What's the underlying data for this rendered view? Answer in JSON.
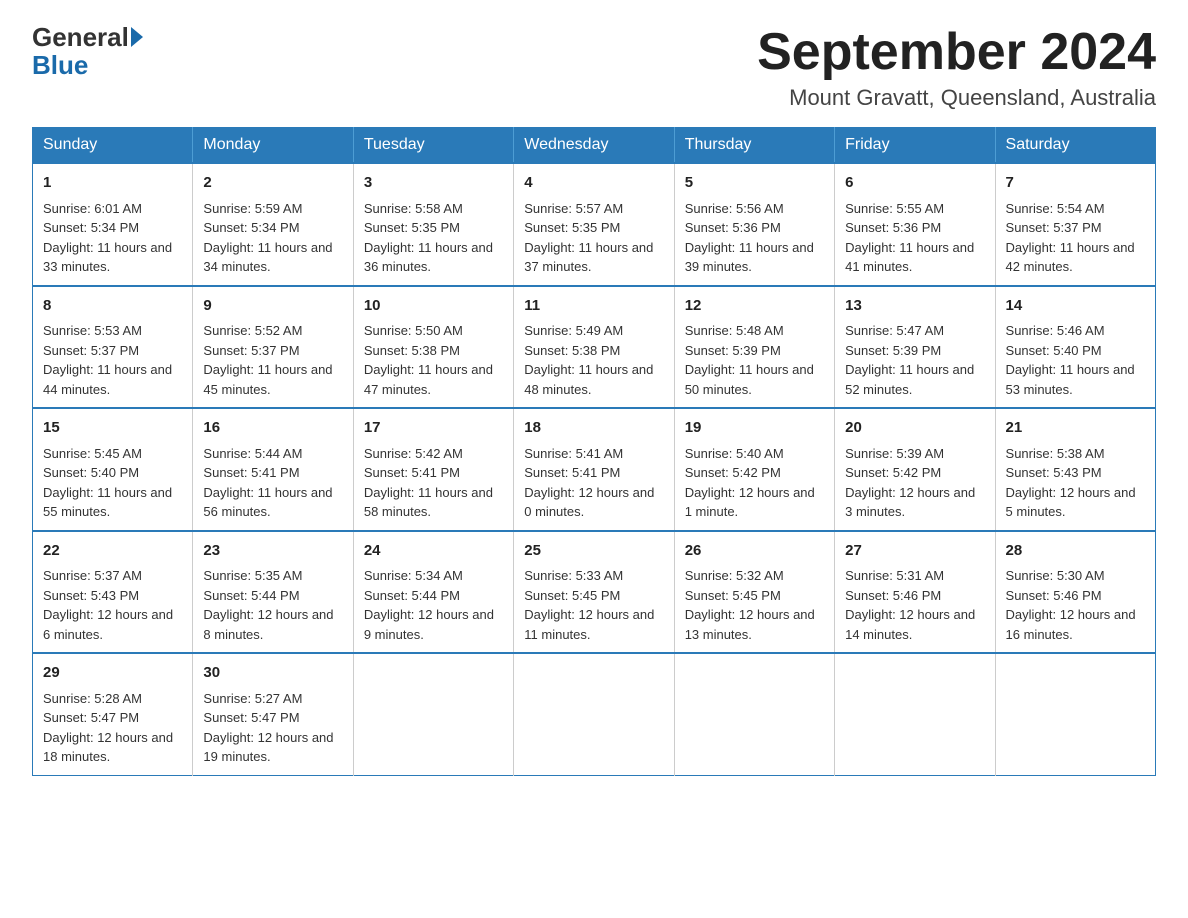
{
  "header": {
    "logo_general": "General",
    "logo_blue": "Blue",
    "month_title": "September 2024",
    "location": "Mount Gravatt, Queensland, Australia"
  },
  "days_of_week": [
    "Sunday",
    "Monday",
    "Tuesday",
    "Wednesday",
    "Thursday",
    "Friday",
    "Saturday"
  ],
  "weeks": [
    [
      {
        "day": "1",
        "sunrise": "6:01 AM",
        "sunset": "5:34 PM",
        "daylight": "11 hours and 33 minutes."
      },
      {
        "day": "2",
        "sunrise": "5:59 AM",
        "sunset": "5:34 PM",
        "daylight": "11 hours and 34 minutes."
      },
      {
        "day": "3",
        "sunrise": "5:58 AM",
        "sunset": "5:35 PM",
        "daylight": "11 hours and 36 minutes."
      },
      {
        "day": "4",
        "sunrise": "5:57 AM",
        "sunset": "5:35 PM",
        "daylight": "11 hours and 37 minutes."
      },
      {
        "day": "5",
        "sunrise": "5:56 AM",
        "sunset": "5:36 PM",
        "daylight": "11 hours and 39 minutes."
      },
      {
        "day": "6",
        "sunrise": "5:55 AM",
        "sunset": "5:36 PM",
        "daylight": "11 hours and 41 minutes."
      },
      {
        "day": "7",
        "sunrise": "5:54 AM",
        "sunset": "5:37 PM",
        "daylight": "11 hours and 42 minutes."
      }
    ],
    [
      {
        "day": "8",
        "sunrise": "5:53 AM",
        "sunset": "5:37 PM",
        "daylight": "11 hours and 44 minutes."
      },
      {
        "day": "9",
        "sunrise": "5:52 AM",
        "sunset": "5:37 PM",
        "daylight": "11 hours and 45 minutes."
      },
      {
        "day": "10",
        "sunrise": "5:50 AM",
        "sunset": "5:38 PM",
        "daylight": "11 hours and 47 minutes."
      },
      {
        "day": "11",
        "sunrise": "5:49 AM",
        "sunset": "5:38 PM",
        "daylight": "11 hours and 48 minutes."
      },
      {
        "day": "12",
        "sunrise": "5:48 AM",
        "sunset": "5:39 PM",
        "daylight": "11 hours and 50 minutes."
      },
      {
        "day": "13",
        "sunrise": "5:47 AM",
        "sunset": "5:39 PM",
        "daylight": "11 hours and 52 minutes."
      },
      {
        "day": "14",
        "sunrise": "5:46 AM",
        "sunset": "5:40 PM",
        "daylight": "11 hours and 53 minutes."
      }
    ],
    [
      {
        "day": "15",
        "sunrise": "5:45 AM",
        "sunset": "5:40 PM",
        "daylight": "11 hours and 55 minutes."
      },
      {
        "day": "16",
        "sunrise": "5:44 AM",
        "sunset": "5:41 PM",
        "daylight": "11 hours and 56 minutes."
      },
      {
        "day": "17",
        "sunrise": "5:42 AM",
        "sunset": "5:41 PM",
        "daylight": "11 hours and 58 minutes."
      },
      {
        "day": "18",
        "sunrise": "5:41 AM",
        "sunset": "5:41 PM",
        "daylight": "12 hours and 0 minutes."
      },
      {
        "day": "19",
        "sunrise": "5:40 AM",
        "sunset": "5:42 PM",
        "daylight": "12 hours and 1 minute."
      },
      {
        "day": "20",
        "sunrise": "5:39 AM",
        "sunset": "5:42 PM",
        "daylight": "12 hours and 3 minutes."
      },
      {
        "day": "21",
        "sunrise": "5:38 AM",
        "sunset": "5:43 PM",
        "daylight": "12 hours and 5 minutes."
      }
    ],
    [
      {
        "day": "22",
        "sunrise": "5:37 AM",
        "sunset": "5:43 PM",
        "daylight": "12 hours and 6 minutes."
      },
      {
        "day": "23",
        "sunrise": "5:35 AM",
        "sunset": "5:44 PM",
        "daylight": "12 hours and 8 minutes."
      },
      {
        "day": "24",
        "sunrise": "5:34 AM",
        "sunset": "5:44 PM",
        "daylight": "12 hours and 9 minutes."
      },
      {
        "day": "25",
        "sunrise": "5:33 AM",
        "sunset": "5:45 PM",
        "daylight": "12 hours and 11 minutes."
      },
      {
        "day": "26",
        "sunrise": "5:32 AM",
        "sunset": "5:45 PM",
        "daylight": "12 hours and 13 minutes."
      },
      {
        "day": "27",
        "sunrise": "5:31 AM",
        "sunset": "5:46 PM",
        "daylight": "12 hours and 14 minutes."
      },
      {
        "day": "28",
        "sunrise": "5:30 AM",
        "sunset": "5:46 PM",
        "daylight": "12 hours and 16 minutes."
      }
    ],
    [
      {
        "day": "29",
        "sunrise": "5:28 AM",
        "sunset": "5:47 PM",
        "daylight": "12 hours and 18 minutes."
      },
      {
        "day": "30",
        "sunrise": "5:27 AM",
        "sunset": "5:47 PM",
        "daylight": "12 hours and 19 minutes."
      },
      null,
      null,
      null,
      null,
      null
    ]
  ],
  "labels": {
    "sunrise": "Sunrise:",
    "sunset": "Sunset:",
    "daylight": "Daylight:"
  }
}
